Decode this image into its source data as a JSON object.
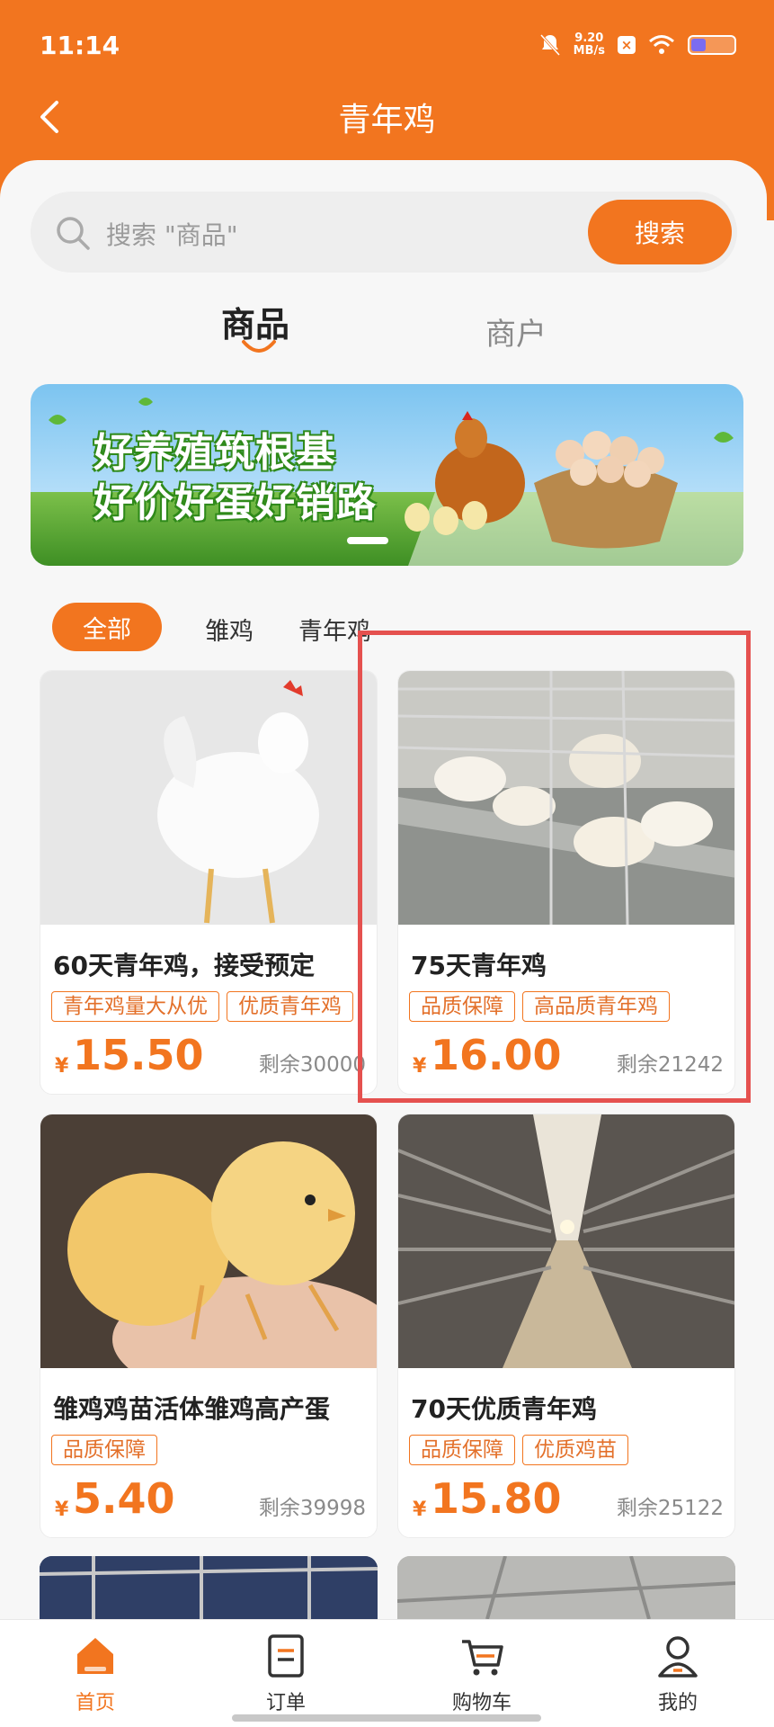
{
  "status_bar": {
    "time": "11:14",
    "network_speed": "9.20",
    "network_speed_unit": "MB/s",
    "icons": [
      "mute-bell-icon",
      "x-badge-icon",
      "wifi-icon",
      "battery-icon"
    ]
  },
  "header": {
    "title": "青年鸡",
    "back_icon": "chevron-left-icon"
  },
  "search": {
    "placeholder": "搜索 \"商品\"",
    "button_label": "搜索"
  },
  "tabs": [
    {
      "label": "商品",
      "active": true
    },
    {
      "label": "商户",
      "active": false
    }
  ],
  "banner": {
    "line1": "好养殖筑根基",
    "line2": "好价好蛋好销路"
  },
  "filters": [
    {
      "label": "全部",
      "active": true
    },
    {
      "label": "雏鸡",
      "active": false
    },
    {
      "label": "青年鸡",
      "active": false
    }
  ],
  "products": [
    {
      "name": "60天青年鸡，接受预定",
      "tags": [
        "青年鸡量大从优",
        "优质青年鸡"
      ],
      "currency": "¥",
      "price": "15.50",
      "stock": "剩余30000"
    },
    {
      "name": "75天青年鸡",
      "tags": [
        "品质保障",
        "高品质青年鸡"
      ],
      "currency": "¥",
      "price": "16.00",
      "stock": "剩余21242"
    },
    {
      "name": "雏鸡鸡苗活体雏鸡高产蛋",
      "tags": [
        "品质保障"
      ],
      "currency": "¥",
      "price": "5.40",
      "stock": "剩余39998"
    },
    {
      "name": "70天优质青年鸡",
      "tags": [
        "品质保障",
        "优质鸡苗"
      ],
      "currency": "¥",
      "price": "15.80",
      "stock": "剩余25122"
    }
  ],
  "bottom_nav": [
    {
      "label": "首页",
      "icon": "home-icon",
      "active": true
    },
    {
      "label": "订单",
      "icon": "order-icon",
      "active": false
    },
    {
      "label": "购物车",
      "icon": "cart-icon",
      "active": false
    },
    {
      "label": "我的",
      "icon": "user-icon",
      "active": false
    }
  ],
  "colors": {
    "accent": "#f2751f",
    "highlight": "#e5514f"
  }
}
